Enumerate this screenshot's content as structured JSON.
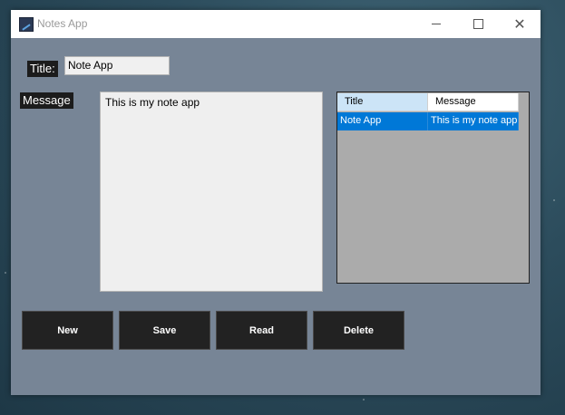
{
  "window": {
    "title": "Notes App",
    "close_glyph": "✕"
  },
  "form": {
    "title_label": "Title:",
    "title_value": "Note App",
    "message_label": "Message",
    "message_value": "This is my note app"
  },
  "grid": {
    "columns": [
      "Title",
      "Message"
    ],
    "rows": [
      [
        "Note App",
        "This is my note app"
      ]
    ]
  },
  "buttons": {
    "new": "New",
    "save": "Save",
    "read": "Read",
    "delete": "Delete"
  },
  "colors": {
    "window_bg": "#778596",
    "selection": "#0078d7",
    "button_bg": "#222222"
  }
}
